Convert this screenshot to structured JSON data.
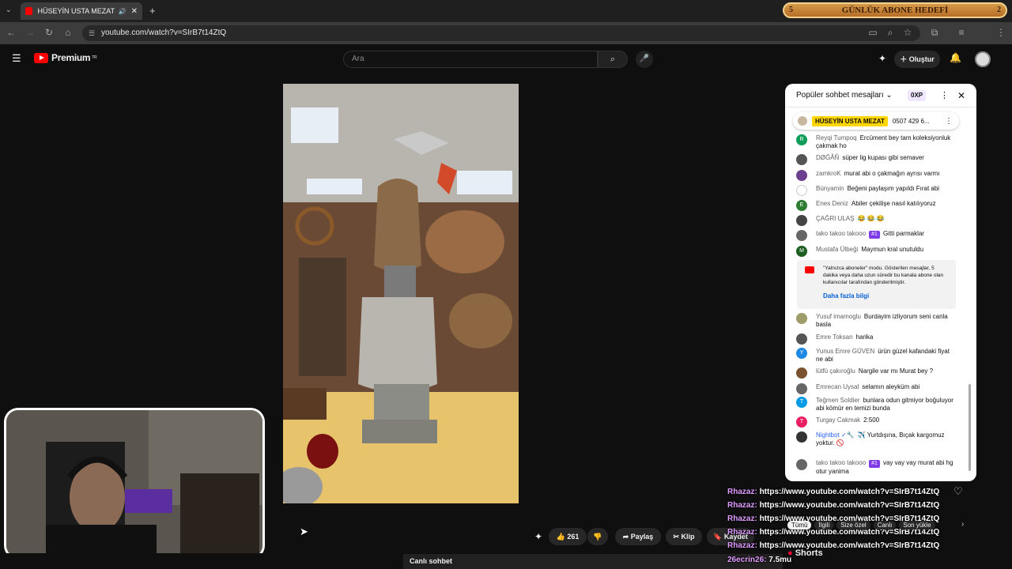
{
  "browser": {
    "tab_title": "HÜSEYİN USTA MEZAT kan",
    "url": "youtube.com/watch?v=SIrB7t14ZtQ",
    "banner": {
      "left": "5",
      "text": "GÜNLÜK ABONE HEDEFİ",
      "right": "2"
    }
  },
  "youtube": {
    "logo_text": "Premium",
    "logo_sup": "TR",
    "search_placeholder": "Ara",
    "create_label": "Oluştur"
  },
  "actions": {
    "likes": "261",
    "share": "Paylaş",
    "clip": "Klip",
    "save": "Kaydet"
  },
  "chat": {
    "header": "Popüler sohbet mesajları",
    "xp": "0XP",
    "pinned": {
      "author": "HÜSEYİN USTA MEZAT",
      "text": "0507 429 6..."
    },
    "messages": [
      {
        "author": "Reyqi Tumpoq",
        "text": "Ercüment bey tam koleksiyonluk çakmak ho",
        "avatar": "R",
        "color": "#0f9d58"
      },
      {
        "author": "DØĞÅÑ",
        "text": "süper lig kupası gibi semaver",
        "avatar": "",
        "color": "#555555"
      },
      {
        "author": "zamkroK",
        "text": "murat abi o çakmağın ayrısı varmı",
        "avatar": "",
        "color": "#6b3e8f"
      },
      {
        "author": "Bünyamin",
        "text": "Beğeni paylaşım yapıldı Fırat abi",
        "avatar": "",
        "color": "#ffffff"
      },
      {
        "author": "Enes Deniz",
        "text": "Abiler çekilişe nasıl katılıyoruz",
        "avatar": "E",
        "color": "#2e7d32"
      },
      {
        "author": "ÇAĞRI ULAŞ",
        "text": "😂 😂 😂",
        "avatar": "",
        "color": "#444444"
      },
      {
        "author": "tako takoo takooo",
        "badge": "#1",
        "text": "Gitti parmaklar",
        "avatar": "",
        "color": "#666666"
      },
      {
        "author": "Mustafa Ülbeği",
        "text": "Maymun kral unutuldu",
        "avatar": "M",
        "color": "#1b5e20"
      },
      {
        "author": "Yusuf imamoglu",
        "text": "Burdayim izliyorum seni canla basla",
        "avatar": "",
        "color": "#9e9d6a"
      },
      {
        "author": "Emre Toksan",
        "text": "harika",
        "avatar": "",
        "color": "#555555"
      },
      {
        "author": "Yunus Emre GÜVEN",
        "text": "ürün güzel kafandaki fiyat ne abi",
        "avatar": "Y",
        "color": "#1e88e5"
      },
      {
        "author": "lütfü çakıroğlu",
        "text": "Nargile var mı Murat bey ?",
        "avatar": "",
        "color": "#7a5230"
      },
      {
        "author": "Emrecan Uysal",
        "text": "selamın aleyküm abi",
        "avatar": "",
        "color": "#666666"
      },
      {
        "author": "Teğmen Soldier",
        "text": "bunlara odun gitmiyor boğuluyor abi kömür en temizi bunda",
        "avatar": "T",
        "color": "#039be5"
      },
      {
        "author": "Turgay Cakmak",
        "text": "2:500",
        "avatar": "T",
        "color": "#e91e63"
      },
      {
        "author": "Nightbot ✓🔧",
        "text": "✈️ Yurtdışına, Bıçak kargomuz yoktur. 🚫",
        "avatar": "",
        "color": "#333333"
      },
      {
        "author": "tako takoo takooo",
        "badge": "#1",
        "text": "vay vay vay murat abi hg otur yanima",
        "avatar": "",
        "color": "#666666"
      }
    ],
    "notice_text": "\"Yalnızca aboneler\" modu. Gösterilen mesajlar, 5 dakika veya daha uzun süredir bu kanala abone olan kullanıcılar tarafından gönderilmiştir.",
    "notice_link": "Daha fazla bilgi"
  },
  "overlay": {
    "rhazaz_name": "Rhazaz:",
    "rhazaz_text": "https://www.youtube.com/watch?v=SIrB7t14ZtQ",
    "bottom_name": "26ecrin26:",
    "bottom_text": "7.5mu",
    "shorts": "Shorts"
  },
  "filters": [
    "Tümü",
    "İlgili",
    "Size özel",
    "Canlı",
    "Son yükle"
  ],
  "live_chat_button": "Canlı sohbet"
}
